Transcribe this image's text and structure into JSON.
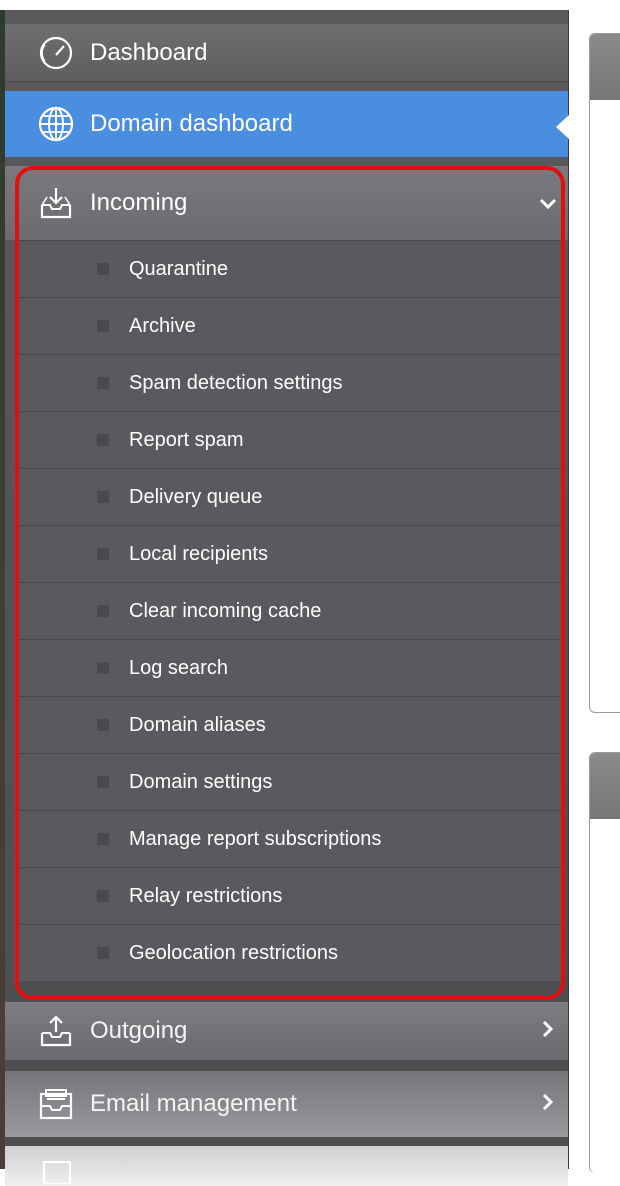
{
  "nav": {
    "dashboard": {
      "label": "Dashboard",
      "icon": "speedometer-icon"
    },
    "domain_dashboard": {
      "label": "Domain dashboard",
      "icon": "globe-icon"
    },
    "incoming": {
      "label": "Incoming",
      "icon": "inbox-download-icon",
      "expanded": true,
      "items": [
        {
          "label": "Quarantine"
        },
        {
          "label": "Archive"
        },
        {
          "label": "Spam detection settings"
        },
        {
          "label": "Report spam"
        },
        {
          "label": "Delivery queue"
        },
        {
          "label": "Local recipients"
        },
        {
          "label": "Clear incoming cache"
        },
        {
          "label": "Log search"
        },
        {
          "label": "Domain aliases"
        },
        {
          "label": "Domain settings"
        },
        {
          "label": "Manage report subscriptions"
        },
        {
          "label": "Relay restrictions"
        },
        {
          "label": "Geolocation restrictions"
        }
      ]
    },
    "outgoing": {
      "label": "Outgoing",
      "icon": "outbox-upload-icon"
    },
    "email_management": {
      "label": "Email management",
      "icon": "envelope-tray-icon"
    }
  },
  "colors": {
    "active": "#4a8fdf",
    "highlight_border": "#e01010",
    "sidebar": "#5a595e"
  }
}
